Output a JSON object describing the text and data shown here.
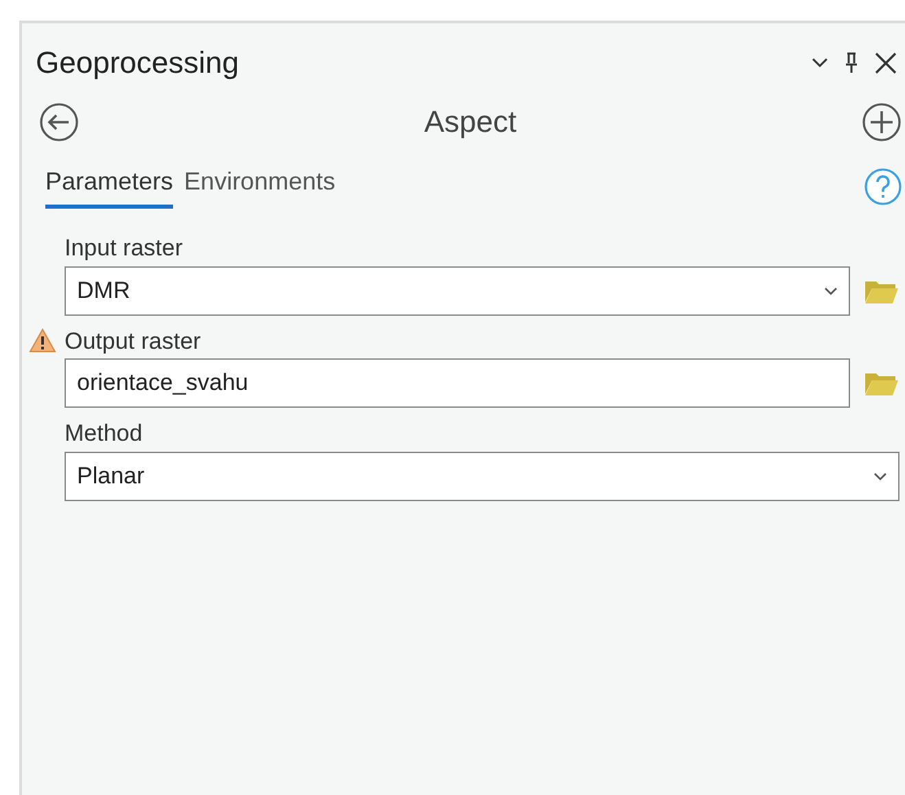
{
  "panel": {
    "title": "Geoprocessing"
  },
  "tool": {
    "name": "Aspect"
  },
  "tabs": [
    {
      "label": "Parameters",
      "selected": true
    },
    {
      "label": "Environments",
      "selected": false
    }
  ],
  "parameters": [
    {
      "label": "Input raster",
      "value": "DMR",
      "kind": "dropdown",
      "warning": false,
      "browse": true
    },
    {
      "label": "Output raster",
      "value": "orientace_svahu",
      "kind": "text",
      "warning": true,
      "browse": true
    },
    {
      "label": "Method",
      "value": "Planar",
      "kind": "dropdown",
      "warning": false,
      "browse": false
    }
  ]
}
